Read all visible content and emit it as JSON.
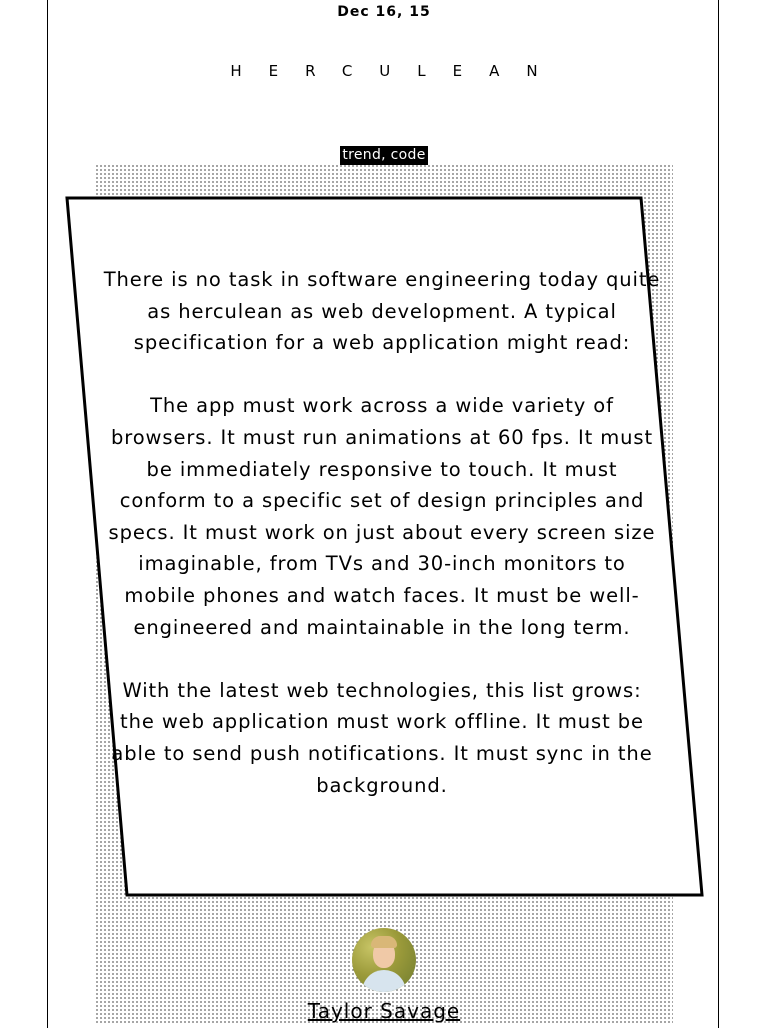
{
  "post": {
    "date": "Dec 16, 15",
    "title": "HERCULEAN",
    "tags": "trend, code",
    "paragraphs": [
      "There is no task in software engineering today quite as herculean as web development. A typical specification for a web application might read:",
      "The app must work across a wide variety of browsers. It must run animations at 60 fps. It must be immediately responsive to touch. It must conform to a specific set of design principles and specs. It must work on just about every screen size imaginable, from TVs and 30-inch monitors to mobile phones and watch faces. It must be well-engineered and maintainable in the long term.",
      "With the latest web technologies, this list grows: the web application must work offline. It must be able to send push notifications. It must sync in the background."
    ]
  },
  "author": {
    "name": "Taylor Savage",
    "avatar_icon": "author-photo"
  }
}
